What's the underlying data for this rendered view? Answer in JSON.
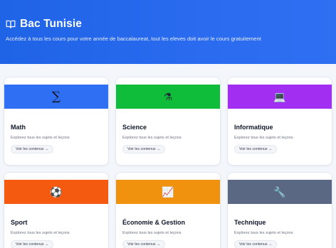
{
  "header": {
    "title": "Bac Tunisie",
    "subtitle": "Accédez à tous les cours pour votre année de baccalaureat, tout les eleves doit avoir le cours gratuitement"
  },
  "courses": [
    {
      "title": "Math",
      "description": "Explorez tous les sujets et leçons",
      "button": "Voir les contenus →",
      "icon": "sigma-icon",
      "glyph": "∑",
      "color": "#2f6ff3"
    },
    {
      "title": "Science",
      "description": "Explorez tous les sujets et leçons",
      "button": "Voir les contenus →",
      "icon": "microscope-icon",
      "glyph": "⚗",
      "color": "#0fbd3a"
    },
    {
      "title": "Informatique",
      "description": "Explorez tous les sujets et leçons",
      "button": "Voir les contenus →",
      "icon": "laptop-icon",
      "glyph": "💻",
      "color": "#a22ef2"
    },
    {
      "title": "Sport",
      "description": "Explorez tous les sujets et leçons",
      "button": "Voir les contenus →",
      "icon": "ball-icon",
      "glyph": "⚽",
      "color": "#f45a10"
    },
    {
      "title": "Économie & Gestion",
      "description": "Explorez tous les sujets et leçons",
      "button": "Voir les contenus →",
      "icon": "chart-icon",
      "glyph": "📈",
      "color": "#f1920e"
    },
    {
      "title": "Technique",
      "description": "Explorez tous les sujets et leçons",
      "button": "Voir les contenus →",
      "icon": "wrench-icon",
      "glyph": "🔧",
      "color": "#5a6883"
    }
  ]
}
